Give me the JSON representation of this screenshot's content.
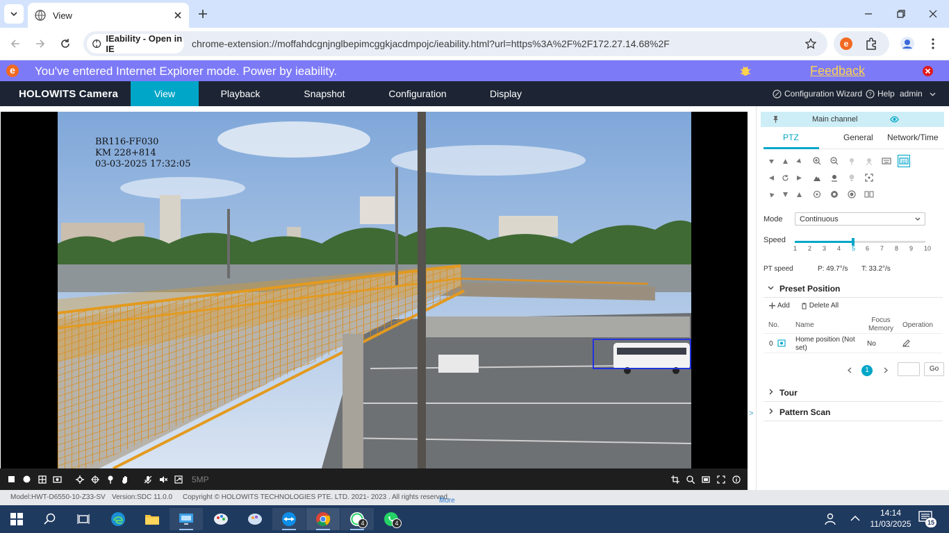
{
  "browser": {
    "tab_title": "View",
    "url": "chrome-extension://moffahdcgnjnglbepimcggkjacdmpojc/ieability.html?url=https%3A%2F%2F172.27.14.68%2F",
    "ie_chip_label": "IEability - Open in IE"
  },
  "ie_banner": {
    "logo": "e",
    "message": "You've entered Internet Explorer mode. Power by ieability.",
    "feedback": "Feedback"
  },
  "app": {
    "brand": "HOLOWITS Camera",
    "tabs": [
      "View",
      "Playback",
      "Snapshot",
      "Configuration",
      "Display"
    ],
    "wizard": "Configuration Wizard",
    "help": "Help",
    "user": "admin"
  },
  "video": {
    "osd": [
      "BR116-FF030",
      "KM 228+814",
      "03-03-2025 17:32:05"
    ],
    "resolution": "5MP"
  },
  "panel": {
    "channel": "Main channel",
    "tabs": [
      "PTZ",
      "General",
      "Network/Time"
    ],
    "mode_label": "Mode",
    "mode_value": "Continuous",
    "speed_label": "Speed",
    "speed_ticks": [
      "1",
      "2",
      "3",
      "4",
      "5",
      "6",
      "7",
      "8",
      "9",
      "10"
    ],
    "speed_value": 5,
    "pt_speed_label": "PT speed",
    "pt_p": "P: 49.7°/s",
    "pt_t": "T: 33.2°/s",
    "preset_title": "Preset Position",
    "add": "Add",
    "delete_all": "Delete All",
    "table_headers": [
      "No.",
      "Name",
      "Focus Memory",
      "Operation"
    ],
    "rows": [
      {
        "no": "0",
        "name": "Home position (Not set)",
        "focus": "No"
      }
    ],
    "page_current": "1",
    "go": "Go",
    "tour": "Tour",
    "pattern": "Pattern Scan"
  },
  "footer": {
    "model": "Model:HWT-D6550-10-Z33-SV",
    "version": "Version:SDC 11.0.0",
    "copyright": "Copyright © HOLOWITS TECHNOLOGIES PTE. LTD. 2021- 2023 . All rights reserved.",
    "more": "More"
  },
  "taskbar": {
    "time": "14:14",
    "date": "11/03/2025",
    "whatsapp_badge": "4",
    "whatsapp2_badge": "4",
    "notifications": "15"
  },
  "colors": {
    "accent": "#00a6c8",
    "nav_bg": "#1d2534",
    "ie_banner": "#7d7af7",
    "railing": "#e39a1f"
  }
}
